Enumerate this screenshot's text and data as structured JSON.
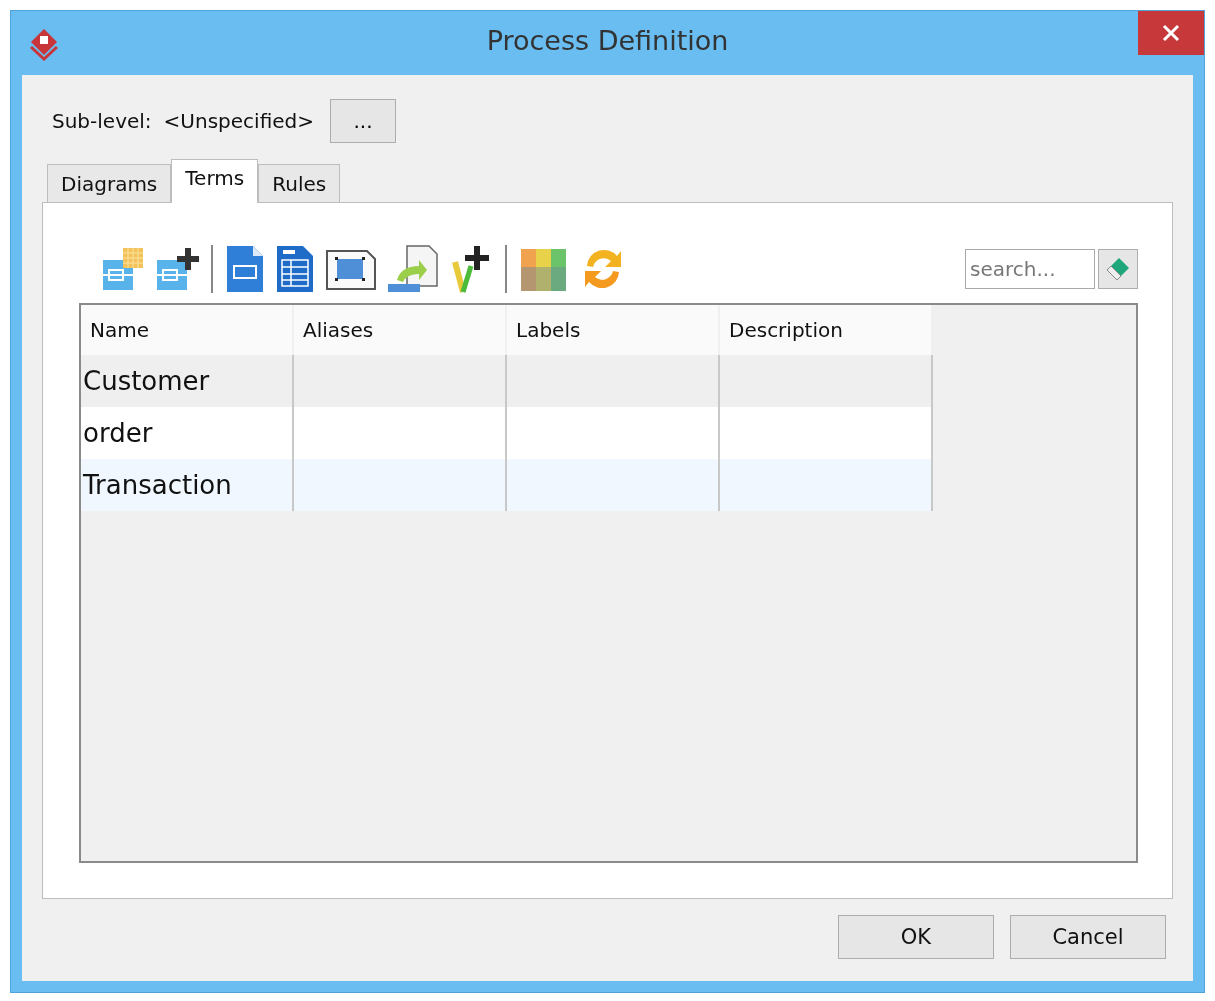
{
  "window": {
    "title": "Process Definition"
  },
  "sub_level": {
    "label": "Sub-level:",
    "value": "<Unspecified>",
    "button": "..."
  },
  "tabs": [
    {
      "label": "Diagrams",
      "selected": false
    },
    {
      "label": "Terms",
      "selected": true
    },
    {
      "label": "Rules",
      "selected": false
    }
  ],
  "search": {
    "placeholder": "search..."
  },
  "table": {
    "columns": [
      "Name",
      "Aliases",
      "Labels",
      "Description"
    ],
    "rows": [
      {
        "cells": [
          "Customer",
          "",
          "",
          ""
        ],
        "selected": true
      },
      {
        "cells": [
          "order",
          "",
          "",
          ""
        ],
        "selected": false
      },
      {
        "cells": [
          "Transaction",
          "",
          "",
          ""
        ],
        "selected": false
      }
    ]
  },
  "buttons": [
    "OK",
    "Cancel"
  ]
}
